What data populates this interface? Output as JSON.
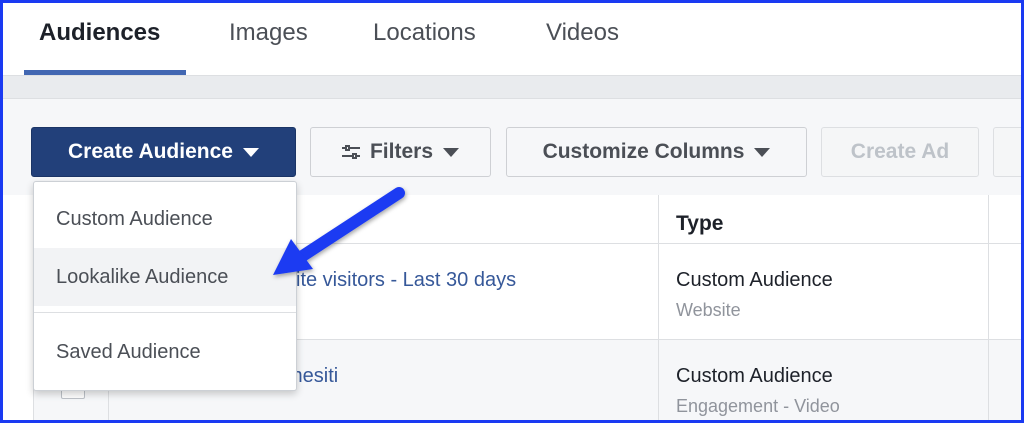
{
  "tabs": [
    {
      "label": "Audiences",
      "active": true
    },
    {
      "label": "Images",
      "active": false
    },
    {
      "label": "Locations",
      "active": false
    },
    {
      "label": "Videos",
      "active": false
    }
  ],
  "toolbar": {
    "create_audience": "Create Audience",
    "filters": "Filters",
    "customize_columns": "Customize Columns",
    "create_ad": "Create Ad"
  },
  "dropdown": {
    "items": [
      "Custom Audience",
      "Lookalike Audience",
      "Saved Audience"
    ],
    "highlighted": "Lookalike Audience"
  },
  "table": {
    "columns": [
      "Type"
    ],
    "rows": [
      {
        "name": "site visitors - Last 30 days",
        "type": "Custom Audience",
        "source": "Website"
      },
      {
        "name": "mesiti",
        "type": "Custom Audience",
        "source": "Engagement - Video"
      }
    ]
  },
  "colors": {
    "frame_border": "#1a3af2",
    "primary_button": "#22407a",
    "tab_underline": "#4267b2",
    "link": "#365899",
    "annotation_arrow": "#1a3af2"
  },
  "icons": [
    "filter-sliders-icon",
    "caret-down-icon",
    "annotation-arrow-icon"
  ]
}
